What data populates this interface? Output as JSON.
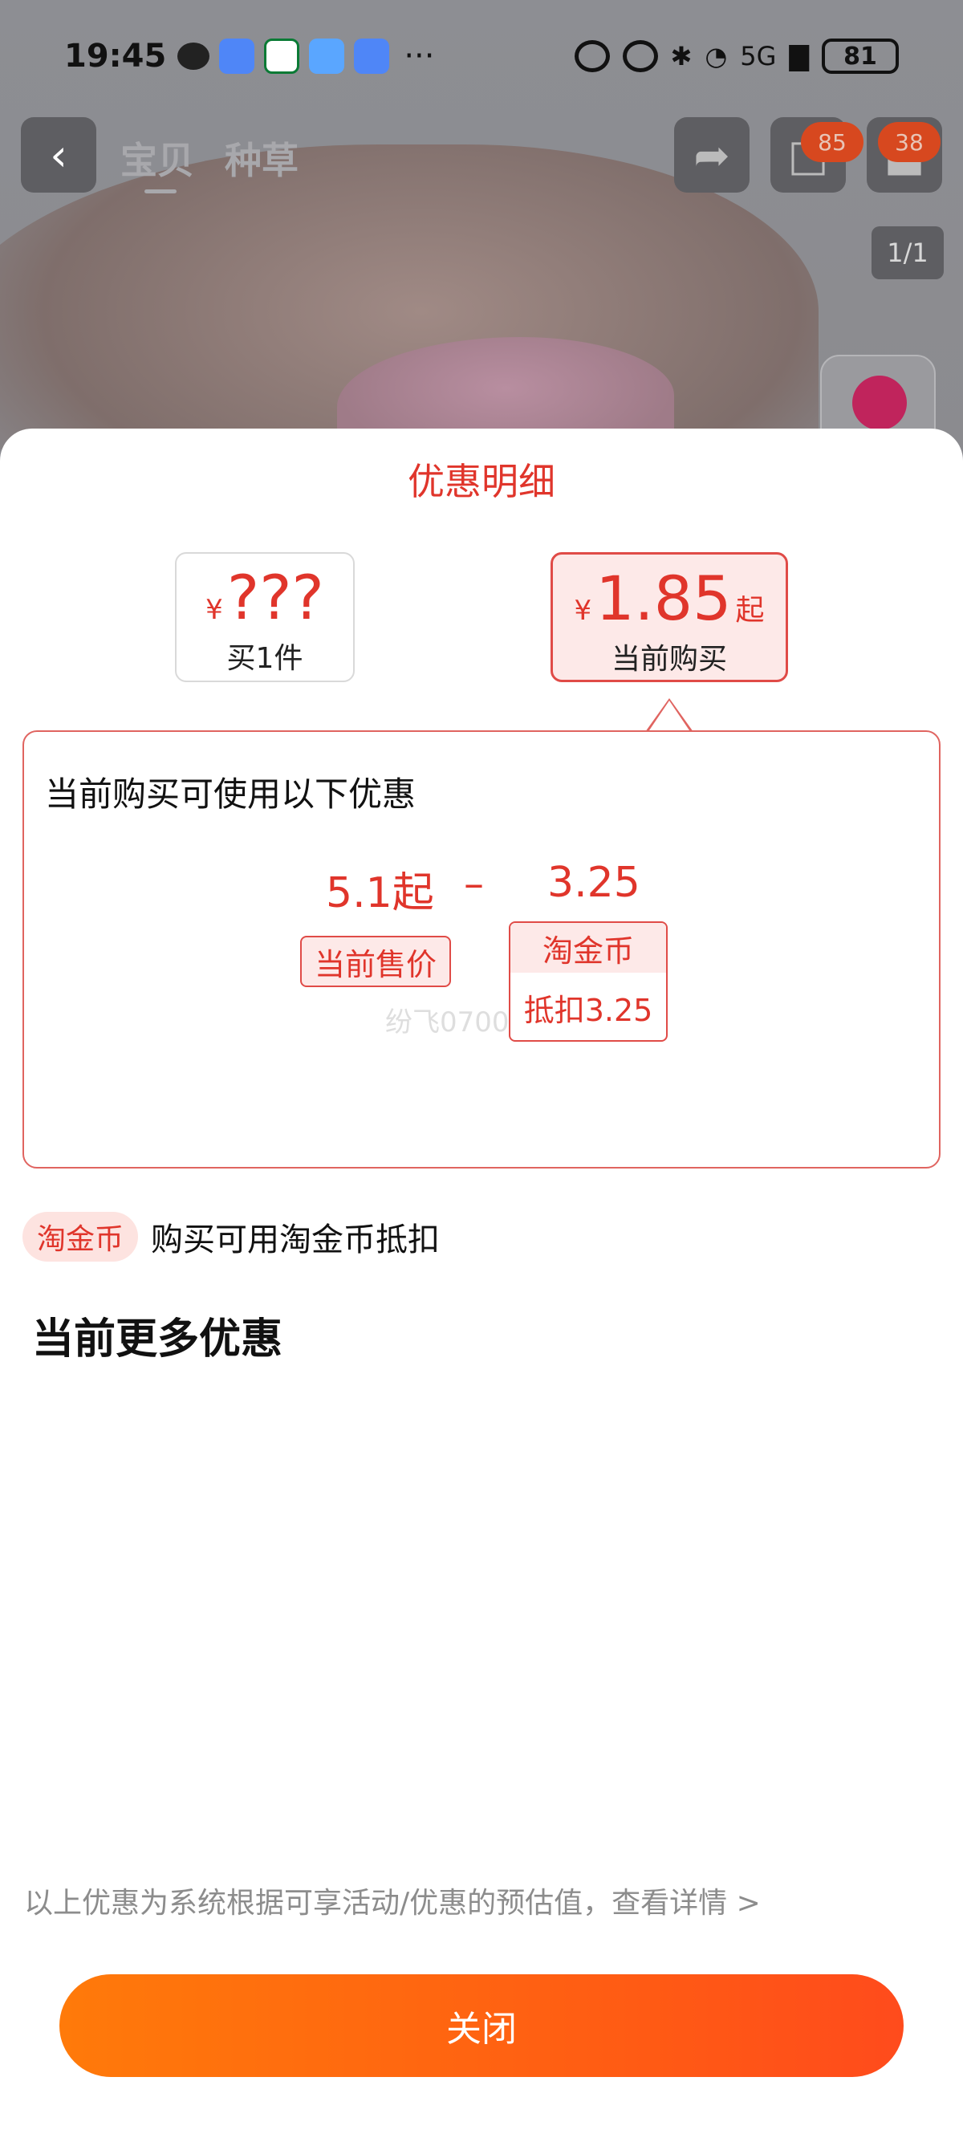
{
  "statusbar": {
    "time": "19:45",
    "more": "···",
    "network": "5G",
    "battery": "81",
    "icons": [
      "wechat-icon",
      "message-icon",
      "china-post-icon",
      "weather-icon",
      "message-icon",
      "eye-icon",
      "alarm-icon",
      "bluetooth-icon",
      "wifi-icon",
      "signal-icon",
      "battery-icon"
    ]
  },
  "topnav": {
    "back_icon": "‹",
    "tabs": [
      "宝贝",
      "种草"
    ],
    "share_icon": "➦",
    "cart_icon": "🛒",
    "cart_badge": "85",
    "more_badge": "38",
    "pager": "1/1"
  },
  "sheet": {
    "title": "优惠明细",
    "buy_one": {
      "yen": "¥",
      "price": "???",
      "label": "买1件"
    },
    "current": {
      "yen": "¥",
      "price": "1.85",
      "suffix": "起",
      "label": "当前购买"
    },
    "detail": {
      "heading": "当前购买可使用以下优惠",
      "base_value": "5.1起",
      "operator": "–",
      "deduct_value": "3.25",
      "base_tag": "当前售价",
      "coin_tag": "淘金币",
      "coin_deduct": "抵扣3.25",
      "watermark": "纷飞0700"
    },
    "coin_pill": "淘金币",
    "coin_text": "购买可用淘金币抵扣",
    "more_title": "当前更多优惠",
    "disclaimer": "以上优惠为系统根据可享活动/优惠的预估值，查看详情 >",
    "close_label": "关闭"
  },
  "colors": {
    "accent_red": "#e0352b",
    "button_orange_start": "#ff7a0a",
    "button_orange_end": "#ff4b1c",
    "tag_bg": "#fde9e8"
  }
}
